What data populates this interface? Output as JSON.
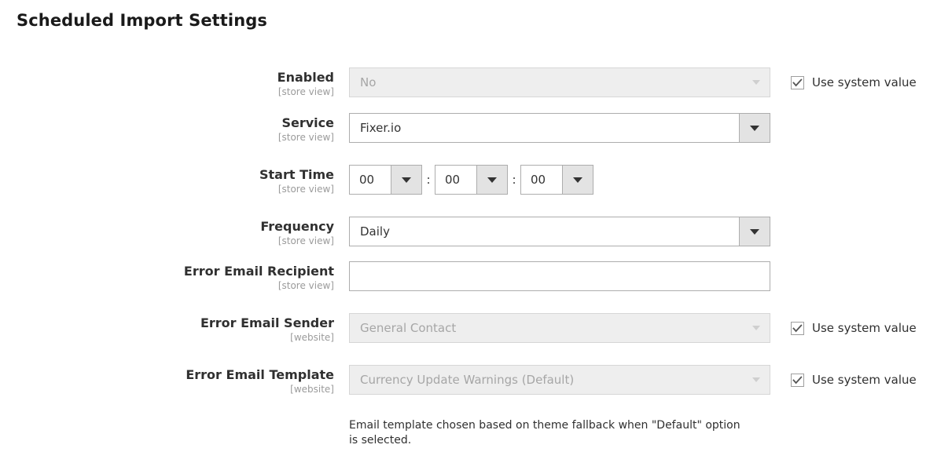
{
  "section": {
    "title": "Scheduled Import Settings"
  },
  "icons": {
    "dropdown": "chevron-down-icon",
    "checkmark": "check-icon"
  },
  "common": {
    "use_system_value": "Use system value",
    "scope_store_view": "[store view]",
    "scope_website": "[website]",
    "time_separator": ":"
  },
  "colors": {
    "text": "#303030",
    "muted": "#9b9b9b",
    "disabled_text": "#a6a6a6",
    "border": "#adadad",
    "disabled_bg": "#eeeeee",
    "button_bg": "#e3e3e3"
  },
  "fields": {
    "enabled": {
      "label": "Enabled",
      "scope": "[store view]",
      "value": "No",
      "use_system_value": "Use system value"
    },
    "service": {
      "label": "Service",
      "scope": "[store view]",
      "value": "Fixer.io"
    },
    "start_time": {
      "label": "Start Time",
      "scope": "[store view]",
      "hours": "00",
      "minutes": "00",
      "seconds": "00",
      "sep1": ":",
      "sep2": ":"
    },
    "frequency": {
      "label": "Frequency",
      "scope": "[store view]",
      "value": "Daily"
    },
    "error_email_recipient": {
      "label": "Error Email Recipient",
      "scope": "[store view]",
      "value": "",
      "placeholder": ""
    },
    "error_email_sender": {
      "label": "Error Email Sender",
      "scope": "[website]",
      "value": "General Contact",
      "use_system_value": "Use system value"
    },
    "error_email_template": {
      "label": "Error Email Template",
      "scope": "[website]",
      "value": "Currency Update Warnings (Default)",
      "use_system_value": "Use system value",
      "note": "Email template chosen based on theme fallback when \"Default\" option is selected."
    }
  }
}
